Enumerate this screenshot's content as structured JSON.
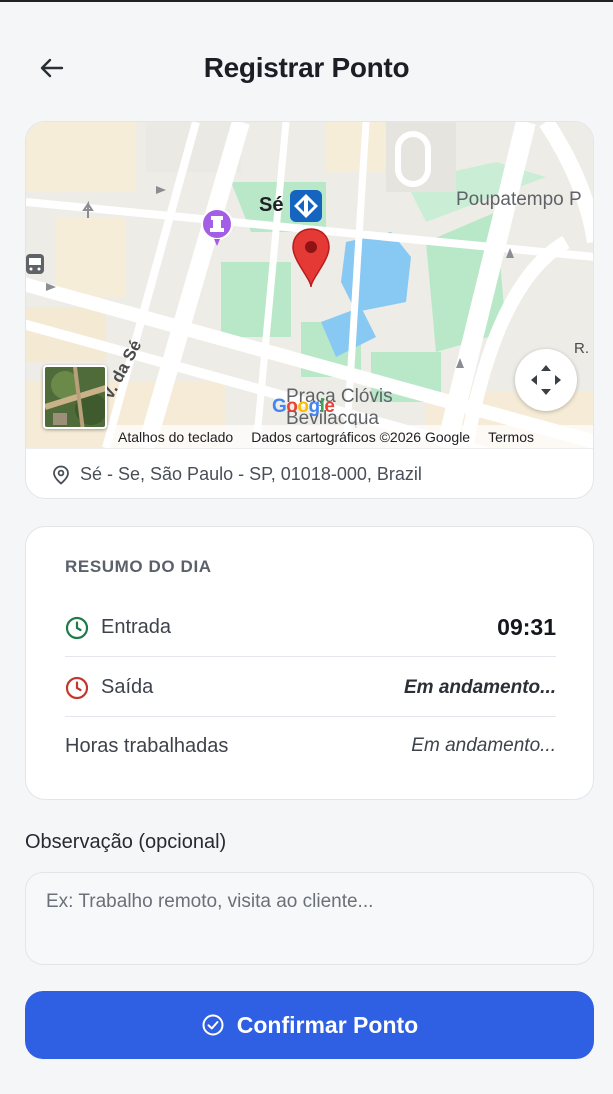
{
  "header": {
    "title": "Registrar Ponto",
    "back_icon": "arrow-left-icon"
  },
  "map": {
    "labels": {
      "se": "Sé",
      "poupatempo": "Poupatempo P",
      "praca_line1": "Praça Clóvis",
      "praca_line2": "Bevilacqua",
      "street_se": "V. da Sé",
      "street_r": "R."
    },
    "google_logo": "Google",
    "attribution": {
      "shortcuts": "Atalhos do teclado",
      "map_data": "Dados cartográficos ©2026 Google",
      "terms": "Termos"
    },
    "icons": {
      "pin": "location-pin-icon",
      "metro": "metro-station-icon",
      "poi": "chess-rook-poi-icon",
      "fullscreen": "fullscreen-icon",
      "satellite": "satellite-thumbnail"
    },
    "colors": {
      "pin": "#e53935",
      "metro": "#1565c0",
      "park": "#b9e8c8",
      "building": "#87c9f2",
      "road": "#ffffff"
    }
  },
  "address": {
    "icon": "map-pin-outline-icon",
    "text": "Sé - Se, São Paulo - SP, 01018-000, Brazil"
  },
  "summary": {
    "title": "RESUMO DO DIA",
    "rows": [
      {
        "icon": "clock-icon",
        "icon_color": "#1f7a4a",
        "label": "Entrada",
        "value": "09:31"
      },
      {
        "icon": "clock-icon",
        "icon_color": "#c0392b",
        "label": "Saída",
        "value": "Em andamento..."
      },
      {
        "label": "Horas trabalhadas",
        "value": "Em andamento..."
      }
    ]
  },
  "observation": {
    "label": "Observação (opcional)",
    "placeholder": "Ex: Trabalho remoto, visita ao cliente...",
    "value": ""
  },
  "confirm": {
    "label": "Confirmar Ponto",
    "icon": "check-circle-icon",
    "color": "#2f5fe3"
  }
}
